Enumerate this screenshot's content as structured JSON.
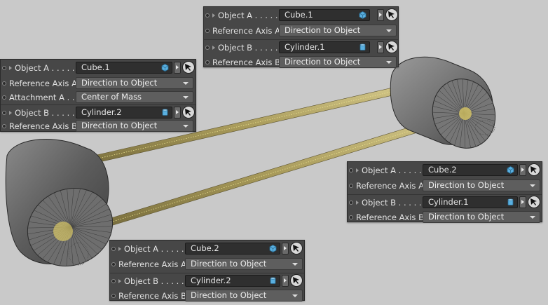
{
  "panels": {
    "top": {
      "object_a_label": "Object A . . . . .",
      "object_a_value": "Cube.1",
      "ref_axis_a_label": "Reference Axis A",
      "ref_axis_a_value": "Direction to Object",
      "object_b_label": "Object B . . . . .",
      "object_b_value": "Cylinder.1",
      "ref_axis_b_label": "Reference Axis B",
      "ref_axis_b_value": "Direction to Object"
    },
    "left": {
      "object_a_label": "Object A . . . . .",
      "object_a_value": "Cube.1",
      "ref_axis_a_label": "Reference Axis A",
      "ref_axis_a_value": "Direction to Object",
      "attachment_a_label": "Attachment A . .",
      "attachment_a_value": "Center of Mass",
      "object_b_label": "Object B . . . . .",
      "object_b_value": "Cylinder.2",
      "ref_axis_b_label": "Reference Axis B",
      "ref_axis_b_value": "Direction to Object"
    },
    "right": {
      "object_a_label": "Object A . . . . .",
      "object_a_value": "Cube.2",
      "ref_axis_a_label": "Reference Axis A",
      "ref_axis_a_value": "Direction to Object",
      "object_b_label": "Object B . . . . .",
      "object_b_value": "Cylinder.1",
      "ref_axis_b_label": "Reference Axis B",
      "ref_axis_b_value": "Direction to Object"
    },
    "bottom": {
      "object_a_label": "Object A . . . . .",
      "object_a_value": "Cube.2",
      "ref_axis_a_label": "Reference Axis A",
      "ref_axis_a_value": "Direction to Object",
      "object_b_label": "Object B . . . . .",
      "object_b_value": "Cylinder.2",
      "ref_axis_b_label": "Reference Axis B",
      "ref_axis_b_value": "Direction to Object"
    }
  },
  "icons": {
    "cube": "cube-icon",
    "cylinder": "cylinder-icon",
    "pick": "pick-object-icon",
    "expand": "expand-arrow-icon"
  },
  "colors": {
    "viewport_bg": "#c9c9c9",
    "panel_bg": "#474747",
    "field_bg": "#2f2f2f",
    "dropdown_bg": "#5e5e5e",
    "rod": "#b7a86a",
    "cube_icon": "#5ab0e0"
  }
}
